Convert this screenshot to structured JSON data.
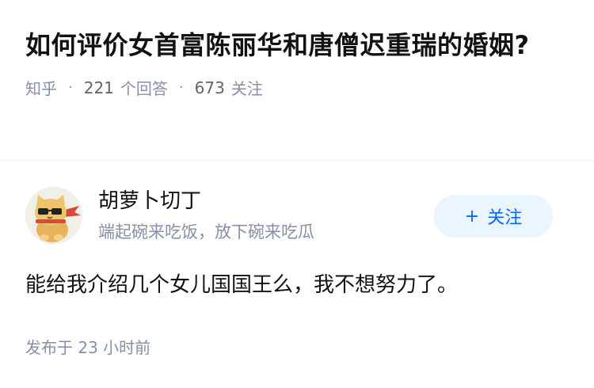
{
  "question": {
    "title": "如何评价女首富陈丽华和唐僧迟重瑞的婚姻?",
    "source": "知乎",
    "answer_count": "221",
    "answer_label": "个回答",
    "follower_count": "673",
    "follower_label": "关注"
  },
  "author": {
    "name": "胡萝卜切丁",
    "bio": "端起碗来吃饭，放下碗来吃瓜",
    "follow_label": "关注",
    "follow_icon": "+"
  },
  "answer": {
    "text": "能给我介绍几个女儿国国王么，我不想努力了。",
    "published_prefix": "发布于",
    "published_value": "23 小时前"
  },
  "colors": {
    "accent": "#0066ff",
    "follow_bg": "#ebf5ff",
    "meta": "#8590a6"
  }
}
